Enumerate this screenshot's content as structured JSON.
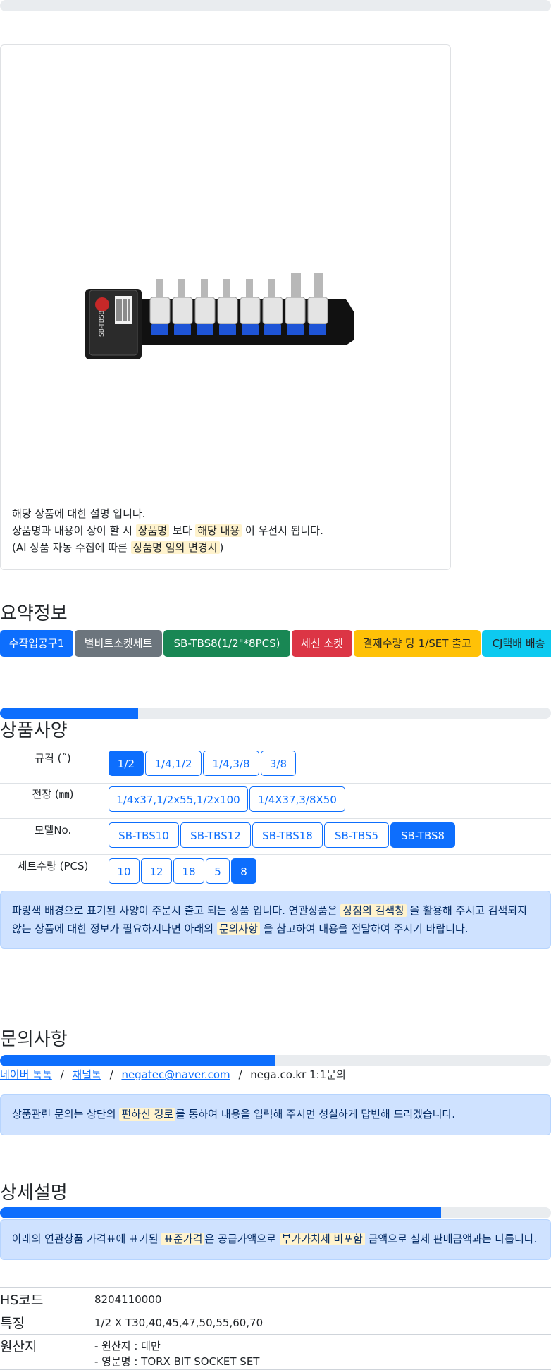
{
  "notice": {
    "line1": "해당 상품에 대한 설명 입니다.",
    "line2_pre": "상품명과 내용이 상이 할 시 ",
    "line2_mark1": "상품명",
    "line2_mid": " 보다 ",
    "line2_mark2": "해당 내용",
    "line2_post": " 이 우선시 됩니다.",
    "line3_pre": "(AI 상품 자동 수집에 따른 ",
    "line3_mark": "상품명 임의 변경시",
    "line3_post": ")"
  },
  "product_image": {
    "icon": "socket-set-image",
    "card_text": "SB-TBS8"
  },
  "summary": {
    "title": "요약정보",
    "badges": [
      {
        "label": "수작업공구1",
        "color": "#0d6efd",
        "text_color": "#ffffff"
      },
      {
        "label": "별비트소켓세트",
        "color": "#6c757d",
        "text_color": "#ffffff"
      },
      {
        "label": "SB-TBS8(1/2\"*8PCS)",
        "color": "#198754",
        "text_color": "#ffffff"
      },
      {
        "label": "세신 소켓",
        "color": "#dc3545",
        "text_color": "#ffffff"
      },
      {
        "label": "결제수량 당 1/SET 출고",
        "color": "#ffc107",
        "text_color": "#212529"
      },
      {
        "label": "CJ택배 배송",
        "color": "#0dcaf0",
        "text_color": "#212529"
      }
    ]
  },
  "specs": {
    "title": "상품사양",
    "progress": 0.25,
    "rows": [
      {
        "label": "규격 (˝)",
        "options": [
          "1/2",
          "1/4,1/2",
          "1/4,3/8",
          "3/8"
        ],
        "selected": 0
      },
      {
        "label": "전장 (㎜)",
        "options": [
          "1/4x37,1/2x55,1/2x100",
          "1/4X37,3/8X50"
        ],
        "selected": -1
      },
      {
        "label": "모델No.",
        "options": [
          "SB-TBS10",
          "SB-TBS12",
          "SB-TBS18",
          "SB-TBS5",
          "SB-TBS8"
        ],
        "selected": 4
      },
      {
        "label": "세트수량 (PCS)",
        "options": [
          "10",
          "12",
          "18",
          "5",
          "8"
        ],
        "selected": 4
      }
    ],
    "info_pre": "파랑색 배경으로 표기된 사양이 주문시 출고 되는 상품 입니다. 연관상품은 ",
    "info_mark1": "상점의 검색창",
    "info_mid": " 을 활용해 주시고 검색되지 않는 상품에 대한 정보가 필요하시다면 아래의 ",
    "info_mark2": "문의사항",
    "info_post": " 을 참고하여 내용을 전달하여 주시기 바랍니다."
  },
  "inquiry": {
    "title": "문의사항",
    "progress": 0.5,
    "links": [
      "네이버 톡톡",
      "채널톡",
      "negatec@naver.com"
    ],
    "separator": "/",
    "plain": "nega.co.kr 1:1문의",
    "alert_pre": "상품관련 문의는 상단의 ",
    "alert_mark": "편하신 경로",
    "alert_post": "를 통하여 내용을 입력해 주시면 성실하게 답변해 드리겠습니다."
  },
  "detail": {
    "title": "상세설명",
    "progress": 0.8,
    "alert_pre": "아래의 연관상품 가격표에 표기된 ",
    "alert_mark1": "표준가격",
    "alert_mid": "은 공급가액으로 ",
    "alert_mark2": "부가가치세 비포함",
    "alert_post": " 금액으로 실제 판매금액과는 다릅니다.",
    "table": [
      {
        "key": "HS코드",
        "values": [
          "8204110000"
        ]
      },
      {
        "key": "특징",
        "values": [
          "1/2 X T30,40,45,47,50,55,60,70"
        ]
      },
      {
        "key": "원산지",
        "values": [
          "- 원산지 : 대만",
          "- 영문명 : TORX BIT SOCKET SET"
        ]
      }
    ]
  }
}
